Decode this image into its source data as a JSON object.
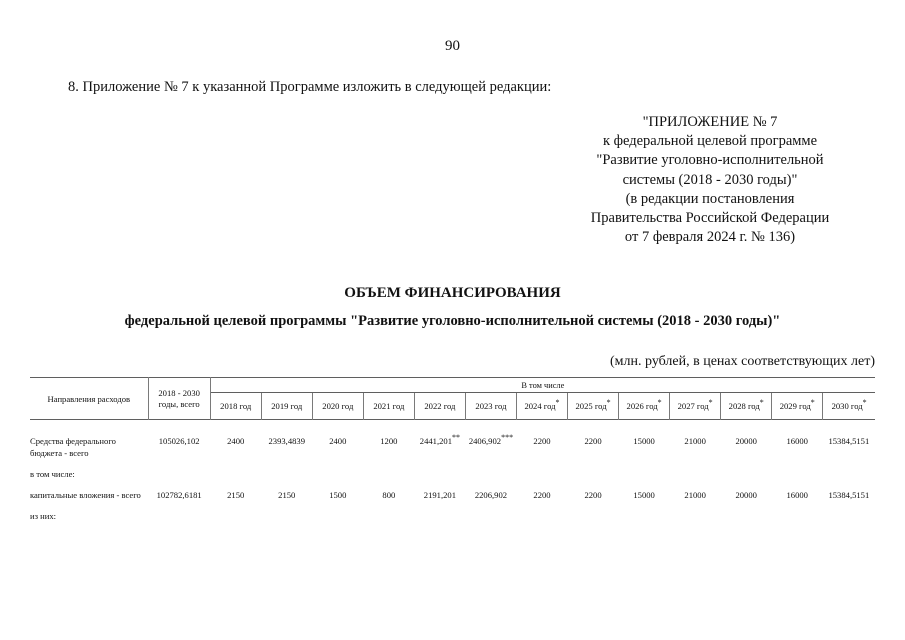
{
  "page": {
    "number": "90"
  },
  "intro": {
    "paragraph": "8. Приложение № 7 к указанной Программе изложить в следующей редакции:"
  },
  "appendix_header": {
    "lines": [
      "\"ПРИЛОЖЕНИЕ № 7",
      "к федеральной целевой программе",
      "\"Развитие уголовно-исполнительной",
      "системы (2018 - 2030 годы)\"",
      "(в редакции постановления",
      "Правительства Российской Федерации",
      "от 7 февраля 2024 г. № 136)"
    ]
  },
  "title": {
    "main": "ОБЪЕМ ФИНАНСИРОВАНИЯ",
    "subtitle": "федеральной целевой программы \"Развитие уголовно-исполнительной системы (2018 - 2030 годы)\""
  },
  "units_note": "(млн. рублей, в ценах соответствующих лет)",
  "table": {
    "header": {
      "directions": "Направления расходов",
      "total": "2018 - 2030 годы, всего",
      "group": "В том числе",
      "years": [
        {
          "label": "2018 год",
          "star": ""
        },
        {
          "label": "2019 год",
          "star": ""
        },
        {
          "label": "2020 год",
          "star": ""
        },
        {
          "label": "2021 год",
          "star": ""
        },
        {
          "label": "2022 год",
          "star": ""
        },
        {
          "label": "2023 год",
          "star": ""
        },
        {
          "label": "2024 год",
          "star": "*"
        },
        {
          "label": "2025 год",
          "star": "*"
        },
        {
          "label": "2026 год",
          "star": "*"
        },
        {
          "label": "2027 год",
          "star": "*"
        },
        {
          "label": "2028 год",
          "star": "*"
        },
        {
          "label": "2029 год",
          "star": "*"
        },
        {
          "label": "2030 год",
          "star": "*"
        }
      ]
    },
    "rows": [
      {
        "label": "Средства федерального бюджета - всего",
        "total": "105026,102",
        "v2018": "2400",
        "v2019": "2393,4839",
        "v2020": "2400",
        "v2021": "1200",
        "v2022": "2441,201",
        "v2022_star": "**",
        "v2023": "2406,902",
        "v2023_star": "***",
        "v2024": "2200",
        "v2025": "2200",
        "v2026": "15000",
        "v2027": "21000",
        "v2028": "20000",
        "v2029": "16000",
        "v2030": "15384,5151"
      },
      {
        "label": "капитальные вложения - всего",
        "total": "102782,6181",
        "v2018": "2150",
        "v2019": "2150",
        "v2020": "1500",
        "v2021": "800",
        "v2022": "2191,201",
        "v2022_star": "",
        "v2023": "2206,902",
        "v2023_star": "",
        "v2024": "2200",
        "v2025": "2200",
        "v2026": "15000",
        "v2027": "21000",
        "v2028": "20000",
        "v2029": "16000",
        "v2030": "15384,5151"
      }
    ],
    "notes": {
      "v_tom_chisle": "в том числе:",
      "iz_nih": "из них:"
    }
  }
}
